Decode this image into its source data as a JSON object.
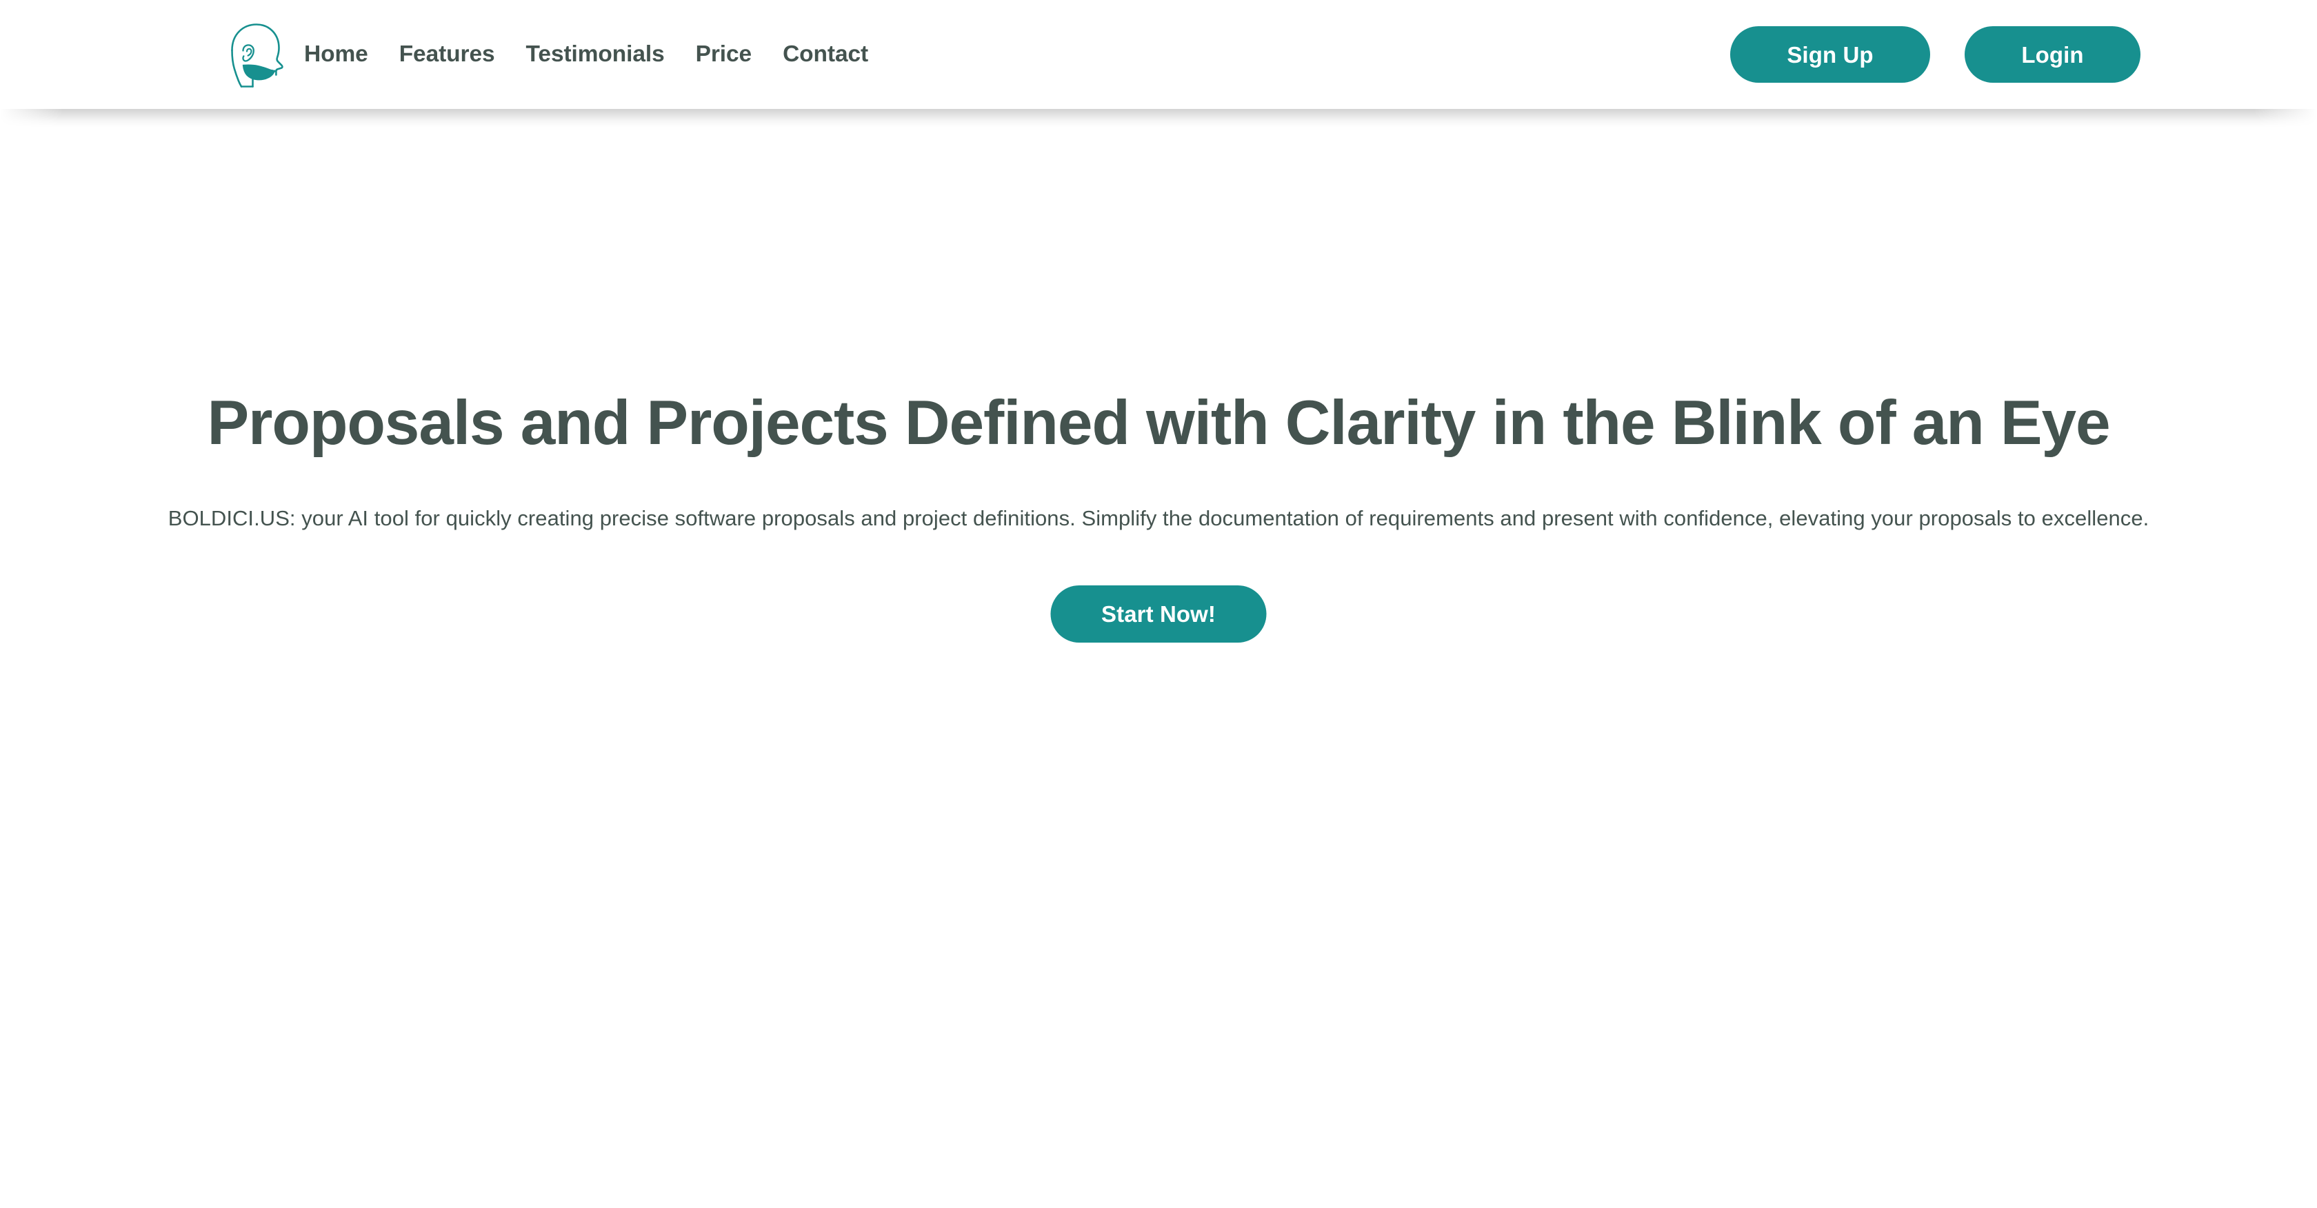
{
  "brand": {
    "logo_icon": "head-profile-icon",
    "accent_color": "#17908F",
    "text_color": "#44534F"
  },
  "header": {
    "nav": [
      {
        "label": "Home",
        "name": "nav-link-home"
      },
      {
        "label": "Features",
        "name": "nav-link-features"
      },
      {
        "label": "Testimonials",
        "name": "nav-link-testimonials"
      },
      {
        "label": "Price",
        "name": "nav-link-price"
      },
      {
        "label": "Contact",
        "name": "nav-link-contact"
      }
    ],
    "signup_label": "Sign Up",
    "login_label": "Login"
  },
  "hero": {
    "title": "Proposals and Projects Defined with Clarity in the Blink of an Eye",
    "subtitle": "BOLDICI.US: your AI tool for quickly creating precise software proposals and project definitions. Simplify the documentation of requirements and present with confidence, elevating your proposals to excellence.",
    "cta_label": "Start Now!"
  }
}
